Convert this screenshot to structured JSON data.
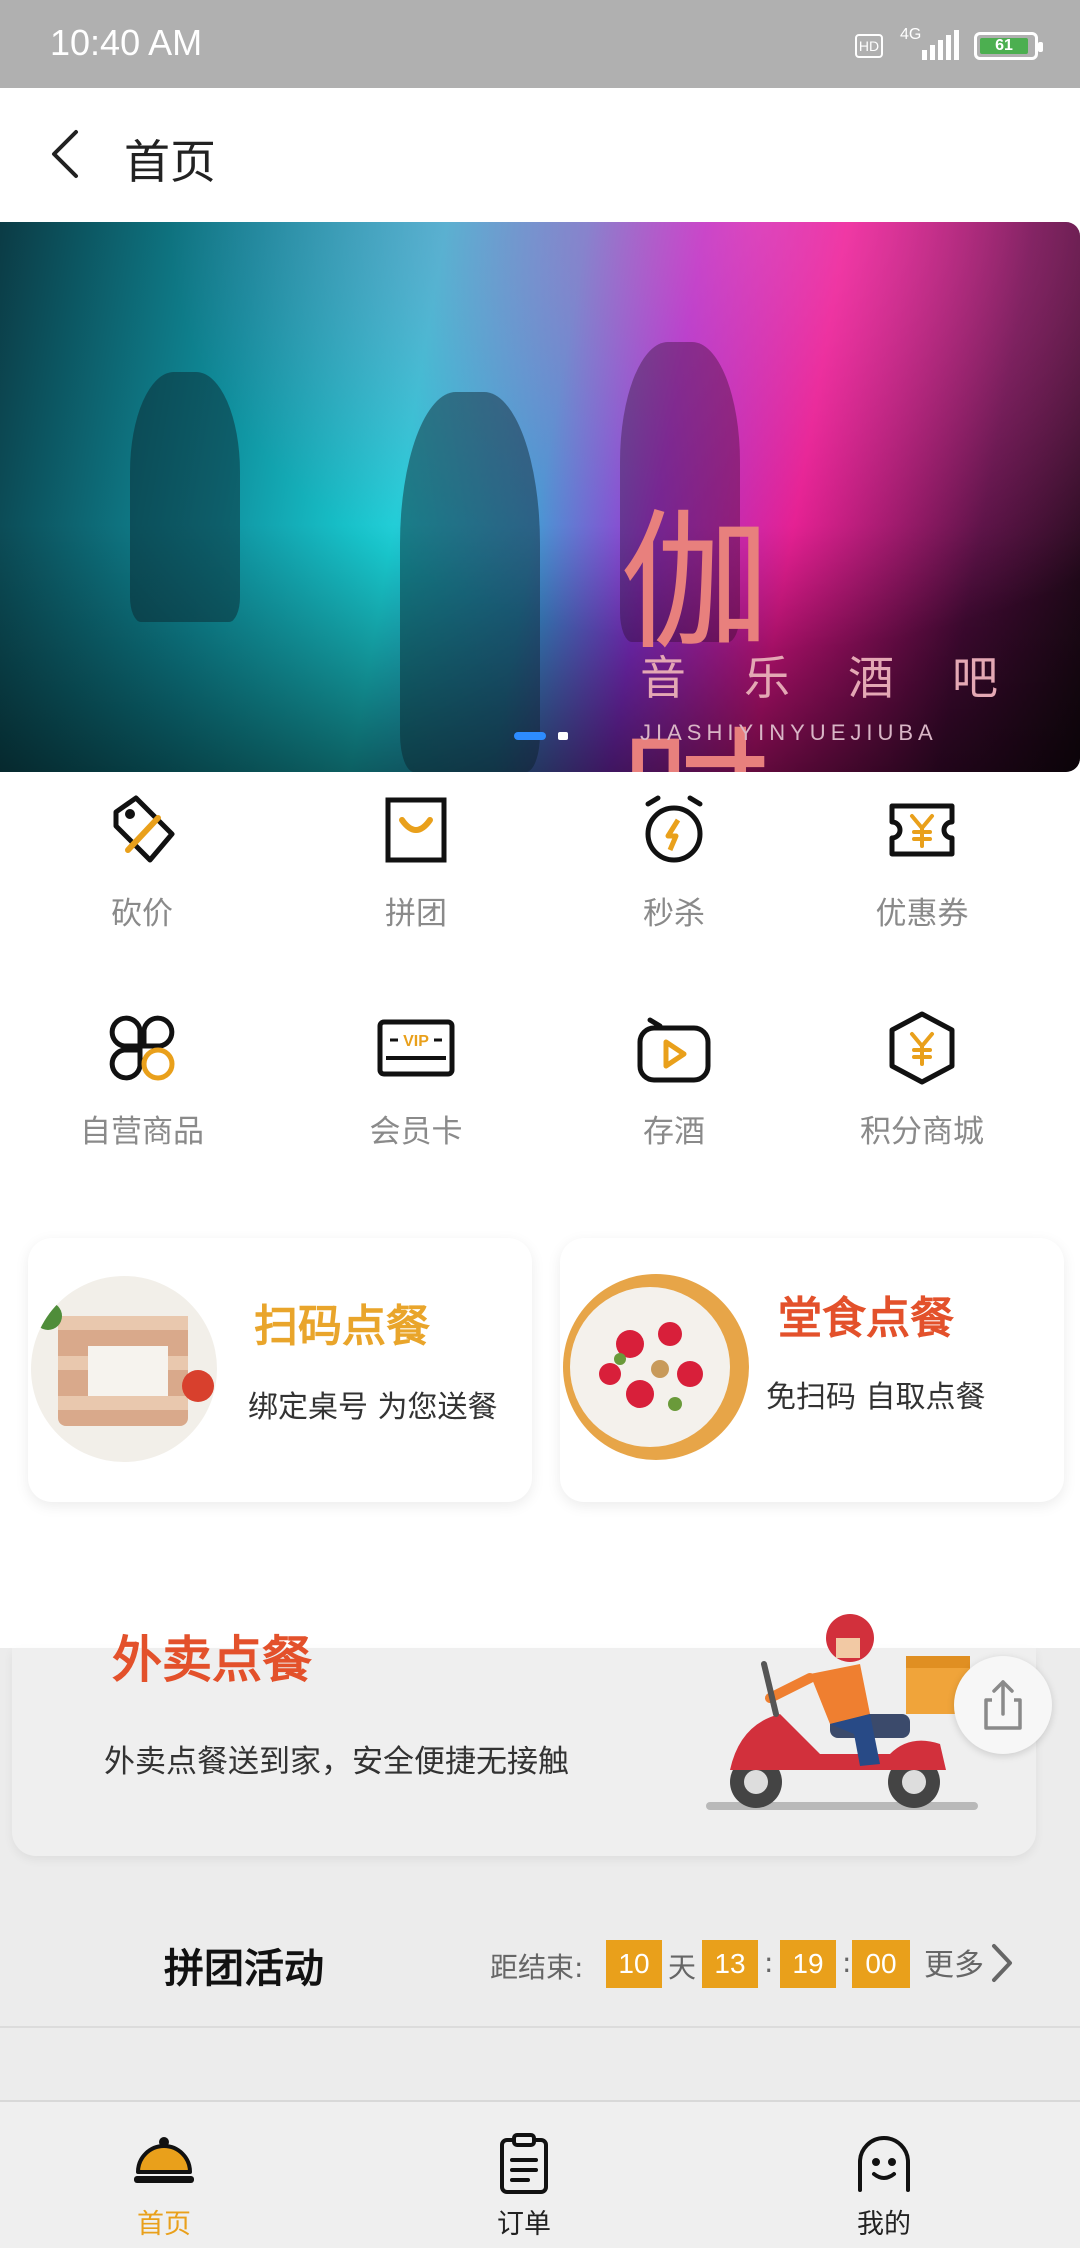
{
  "status_bar": {
    "time": "10:40 AM",
    "hd": "HD",
    "network": "4G",
    "battery": "61"
  },
  "header": {
    "title": "首页"
  },
  "banner": {
    "title": "伽时",
    "subtitle": "音乐酒吧",
    "english": "JIASHIYINYUEJIUBA"
  },
  "features": [
    {
      "label": "砍价",
      "icon": "price-tag-icon"
    },
    {
      "label": "拼团",
      "icon": "shopping-bag-icon"
    },
    {
      "label": "秒杀",
      "icon": "alarm-clock-icon"
    },
    {
      "label": "优惠券",
      "icon": "coupon-icon"
    },
    {
      "label": "自营商品",
      "icon": "clover-icon"
    },
    {
      "label": "会员卡",
      "icon": "vip-card-icon"
    },
    {
      "label": "存酒",
      "icon": "play-box-icon"
    },
    {
      "label": "积分商城",
      "icon": "yen-hexagon-icon"
    }
  ],
  "cards": {
    "scan": {
      "title": "扫码点餐",
      "desc": "绑定桌号 为您送餐",
      "title_color": "#e9a52b"
    },
    "dine": {
      "title": "堂食点餐",
      "desc": "免扫码 自取点餐",
      "title_color": "#e3512b"
    }
  },
  "delivery": {
    "title": "外卖点餐",
    "desc": "外卖点餐送到家，安全便捷无接触"
  },
  "group_buy": {
    "title": "拼团活动",
    "countdown_label": "距结束:",
    "days": "10",
    "day_unit": "天",
    "hours": "13",
    "minutes": "19",
    "seconds": "00",
    "more": "更多"
  },
  "tabs": [
    {
      "label": "首页",
      "icon": "home-dome-icon",
      "active": true
    },
    {
      "label": "订单",
      "icon": "clipboard-icon",
      "active": false
    },
    {
      "label": "我的",
      "icon": "profile-face-icon",
      "active": false
    }
  ],
  "colors": {
    "accent": "#e9a01b",
    "orange_red": "#e3512b"
  }
}
